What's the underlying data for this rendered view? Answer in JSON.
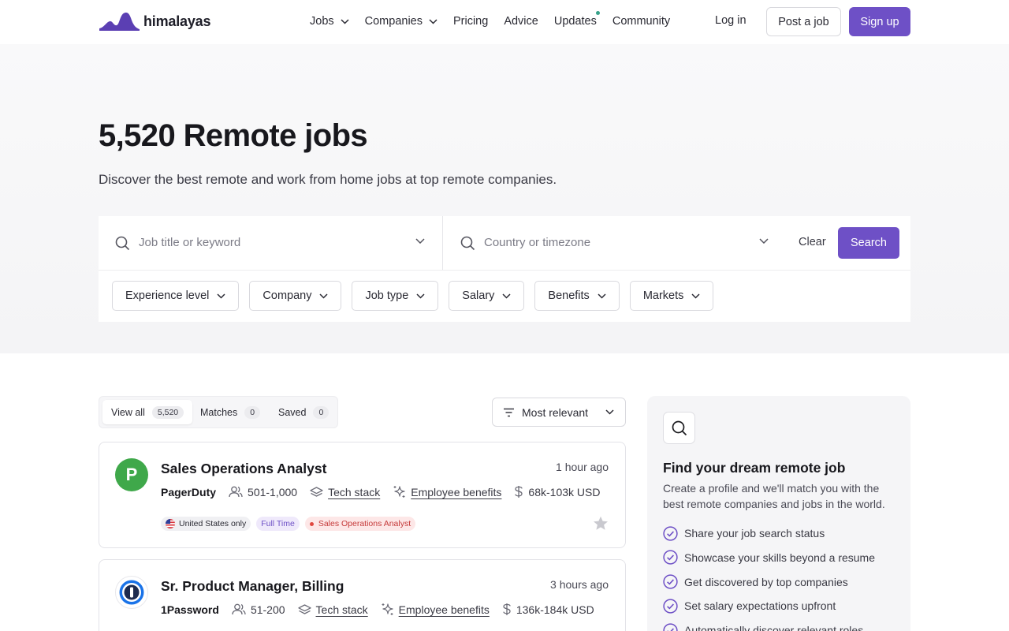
{
  "brand": {
    "name": "himalayas",
    "accent": "#6e50c6"
  },
  "nav": {
    "links": [
      {
        "label": "Jobs",
        "dropdown": true
      },
      {
        "label": "Companies",
        "dropdown": true
      },
      {
        "label": "Pricing"
      },
      {
        "label": "Advice"
      },
      {
        "label": "Updates",
        "badge_dot": true
      },
      {
        "label": "Community"
      }
    ],
    "login": "Log in",
    "post_job": "Post a job",
    "signup": "Sign up"
  },
  "hero": {
    "title": "5,520 Remote jobs",
    "subtitle": "Discover the best remote and work from home jobs at top remote companies."
  },
  "search": {
    "keyword_placeholder": "Job title or keyword",
    "location_placeholder": "Country or timezone",
    "clear": "Clear",
    "submit": "Search"
  },
  "filters": [
    "Experience level",
    "Company",
    "Job type",
    "Salary",
    "Benefits",
    "Markets"
  ],
  "tabs": [
    {
      "label": "View all",
      "count": "5,520",
      "active": true
    },
    {
      "label": "Matches",
      "count": "0"
    },
    {
      "label": "Saved",
      "count": "0"
    }
  ],
  "sort": {
    "label": "Most relevant"
  },
  "jobs": [
    {
      "title": "Sales Operations Analyst",
      "time": "1 hour ago",
      "company": "PagerDuty",
      "size": "501-1,000",
      "tech_stack": "Tech stack",
      "benefits": "Employee benefits",
      "salary": "68k-103k USD",
      "tags": {
        "location": "United States only",
        "type": "Full Time",
        "role": "Sales Operations Analyst"
      },
      "logo_letter": "P",
      "logo_color": "#3fa84a"
    },
    {
      "title": "Sr. Product Manager, Billing",
      "time": "3 hours ago",
      "company": "1Password",
      "size": "51-200",
      "tech_stack": "Tech stack",
      "benefits": "Employee benefits",
      "salary": "136k-184k USD",
      "logo_color": "#1a73e8"
    }
  ],
  "promo": {
    "title": "Find your dream remote job",
    "description": "Create a profile and we'll match you with the best remote companies and jobs in the world.",
    "items": [
      "Share your job search status",
      "Showcase your skills beyond a resume",
      "Get discovered by top companies",
      "Set salary expectations upfront",
      "Automatically discover relevant roles"
    ]
  }
}
